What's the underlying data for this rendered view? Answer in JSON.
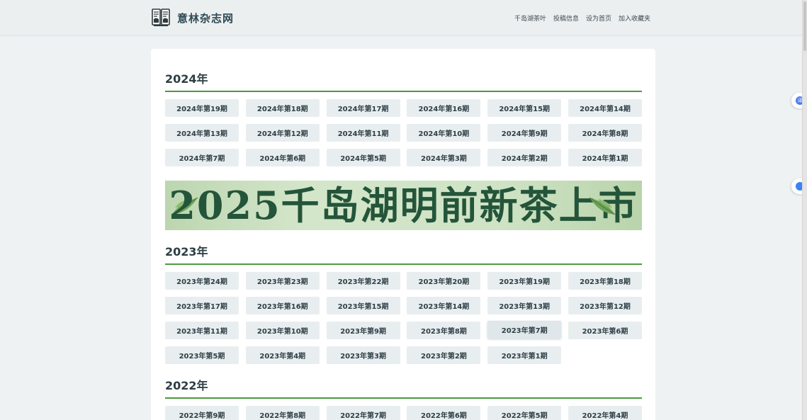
{
  "header": {
    "site_title": "意林杂志网",
    "logo_icon": "book-logo-icon",
    "links": [
      "千岛湖茶叶",
      "投稿信息",
      "设为首页",
      "加入收藏夹"
    ]
  },
  "banner": {
    "text": "2025千岛湖明前新茶上市"
  },
  "sections": [
    {
      "year": "2024年",
      "issues": [
        "2024年第19期",
        "2024年第18期",
        "2024年第17期",
        "2024年第16期",
        "2024年第15期",
        "2024年第14期",
        "2024年第13期",
        "2024年第12期",
        "2024年第11期",
        "2024年第10期",
        "2024年第9期",
        "2024年第8期",
        "2024年第7期",
        "2024年第6期",
        "2024年第5期",
        "2024年第3期",
        "2024年第2期",
        "2024年第1期"
      ]
    },
    {
      "year": "2023年",
      "issues": [
        "2023年第24期",
        "2023年第23期",
        "2023年第22期",
        "2023年第20期",
        "2023年第19期",
        "2023年第18期",
        "2023年第17期",
        "2023年第16期",
        "2023年第15期",
        "2023年第14期",
        "2023年第13期",
        "2023年第12期",
        "2023年第11期",
        "2023年第10期",
        "2023年第9期",
        "2023年第8期",
        "2023年第7期",
        "2023年第6期",
        "2023年第5期",
        "2023年第4期",
        "2023年第3期",
        "2023年第2期",
        "2023年第1期"
      ]
    },
    {
      "year": "2022年",
      "issues": [
        "2022年第9期",
        "2022年第8期",
        "2022年第7期",
        "2022年第6期",
        "2022年第5期",
        "2022年第4期"
      ]
    }
  ],
  "side_buttons": [
    {
      "icon": "translate-icon",
      "label": "译"
    },
    {
      "icon": "chat-icon",
      "label": ""
    }
  ],
  "colors": {
    "accent_green": "#4a9a3c",
    "button_bg": "#e8eef0",
    "page_bg": "#eef2f3"
  }
}
